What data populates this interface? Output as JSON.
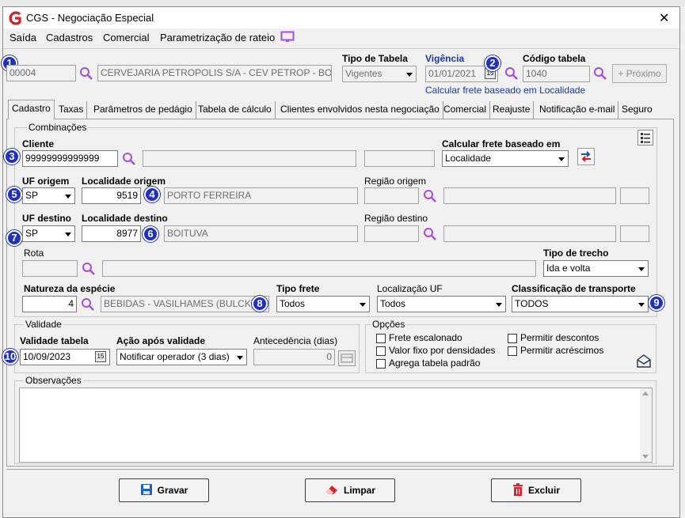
{
  "window": {
    "title": "CGS - Negociação Especial",
    "close_glyph": "✕"
  },
  "menu": {
    "items": [
      "Saída",
      "Cadastros",
      "Comercial",
      "Parametrização de rateio"
    ]
  },
  "header": {
    "company_code": "00004",
    "company_name": "CERVEJARIA PETROPOLIS S/A  -  CEV PETROP - BOI",
    "tipo_tabela_label": "Tipo de Tabela",
    "tipo_tabela_value": "Vigentes",
    "vigencia_label": "Vigência",
    "vigencia_value": "01/01/2021",
    "vigencia_note": "Calcular frete baseado em Localidade",
    "codigo_tabela_label": "Código tabela",
    "codigo_tabela_value": "1040",
    "proximo_label": "Próximo"
  },
  "tabs": [
    "Cadastro",
    "Taxas",
    "Parâmetros de pedágio",
    "Tabela de cálculo",
    "Clientes envolvidos nesta negociação",
    "Comercial",
    "Reajuste",
    "Notificação e-mail",
    "Seguro"
  ],
  "combinacoes": {
    "title": "Combinações",
    "cliente_label": "Cliente",
    "cliente_value": "99999999999999",
    "calc_frete_label": "Calcular frete baseado em",
    "calc_frete_value": "Localidade",
    "uf_origem_label": "UF origem",
    "uf_origem_value": "SP",
    "localidade_origem_label": "Localidade origem",
    "localidade_origem_code": "9519",
    "localidade_origem_name": "PORTO FERREIRA",
    "regiao_origem_label": "Região origem",
    "uf_destino_label": "UF destino",
    "uf_destino_value": "SP",
    "localidade_destino_label": "Localidade destino",
    "localidade_destino_code": "8977",
    "localidade_destino_name": "BOITUVA",
    "regiao_destino_label": "Região destino",
    "rota_label": "Rota",
    "tipo_trecho_label": "Tipo de trecho",
    "tipo_trecho_value": "Ida e volta",
    "natureza_label": "Natureza da espécie",
    "natureza_code": "4",
    "natureza_name": "BEBIDAS - VASILHAMES (BULCK)",
    "tipo_frete_label": "Tipo frete",
    "tipo_frete_value": "Todos",
    "localizacao_uf_label": "Localização UF",
    "localizacao_uf_value": "Todos",
    "classificacao_label": "Classificação de transporte",
    "classificacao_value": "TODOS"
  },
  "validade": {
    "title": "Validade",
    "validade_tabela_label": "Validade tabela",
    "validade_tabela_value": "10/09/2023",
    "acao_label": "Ação após validade",
    "acao_value": "Notificar operador (3 dias)",
    "antecedencia_label": "Antecedência (dias)",
    "antecedencia_value": "0"
  },
  "opcoes": {
    "title": "Opções",
    "frete_escalonado": "Frete escalonado",
    "valor_fixo": "Valor fixo por densidades",
    "agrega_tabela": "Agrega tabela padrão",
    "permitir_descontos": "Permitir descontos",
    "permitir_acrescimos": "Permitir acréscimos"
  },
  "observacoes": {
    "title": "Observações"
  },
  "actions": {
    "gravar": "Gravar",
    "limpar": "Limpar",
    "excluir": "Excluir"
  },
  "badges": [
    "1",
    "2",
    "3",
    "4",
    "5",
    "6",
    "7",
    "8",
    "9",
    "10"
  ],
  "colors": {
    "badge": "#1f2fbf",
    "magnifier": "#a64fd6",
    "logo": "#cc1f2a",
    "link": "#1a3a99"
  }
}
